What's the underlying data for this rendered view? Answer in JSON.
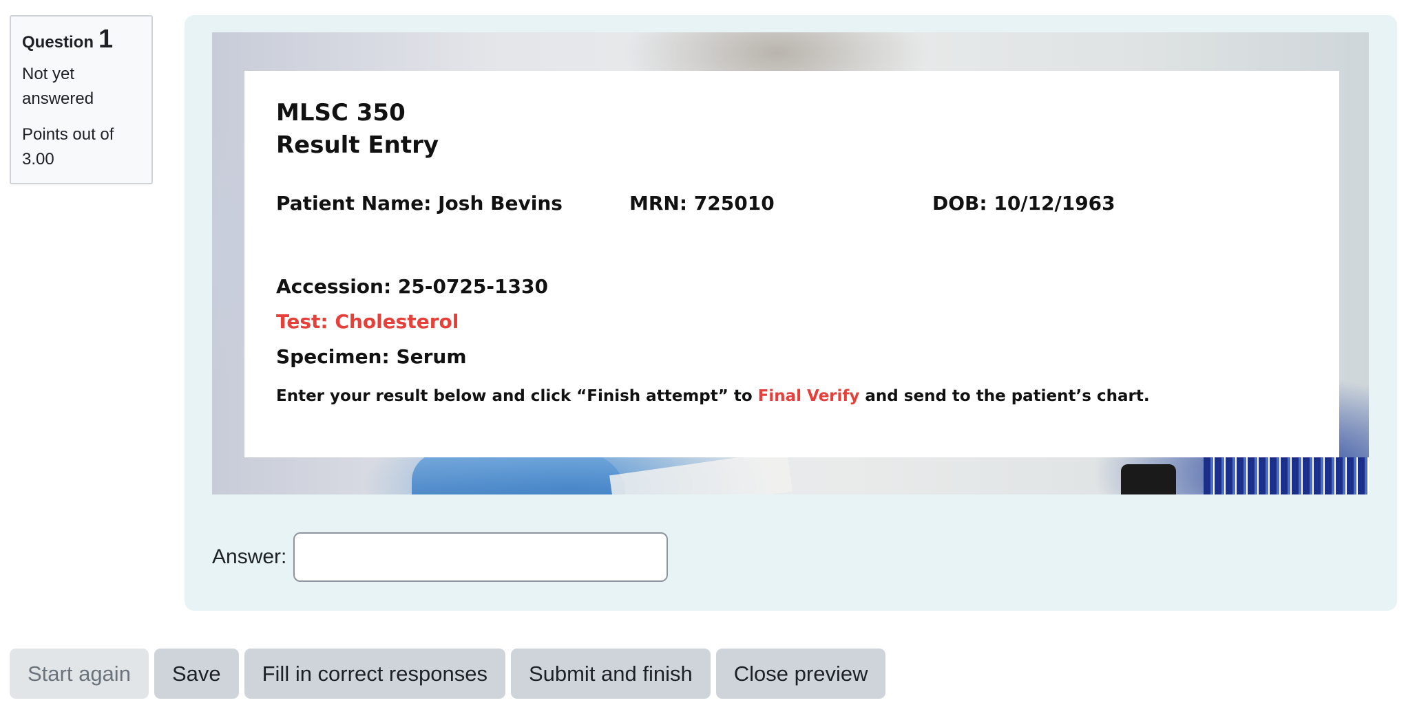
{
  "question_info": {
    "label": "Question",
    "number": "1",
    "state": "Not yet answered",
    "grade": "Points out of 3.00"
  },
  "card": {
    "course": "MLSC 350",
    "subtitle": "Result Entry",
    "patient_name": "Patient Name: Josh Bevins",
    "mrn": "MRN: 725010",
    "dob": "DOB: 10/12/1963",
    "accession": "Accession: 25-0725-1330",
    "test": "Test: Cholesterol",
    "specimen": "Specimen: Serum",
    "instruction_before": "Enter your result below and click “Finish attempt” to ",
    "instruction_highlight": "Final Verify",
    "instruction_after": " and send to the patient’s chart."
  },
  "answer": {
    "label": "Answer:",
    "value": ""
  },
  "buttons": {
    "start_again": "Start again",
    "save": "Save",
    "fill_correct": "Fill in correct responses",
    "submit_finish": "Submit and finish",
    "close_preview": "Close preview"
  },
  "colors": {
    "panel_background": "#e7f3f5",
    "highlight_red": "#e5413a",
    "button_background": "#ced4da"
  }
}
